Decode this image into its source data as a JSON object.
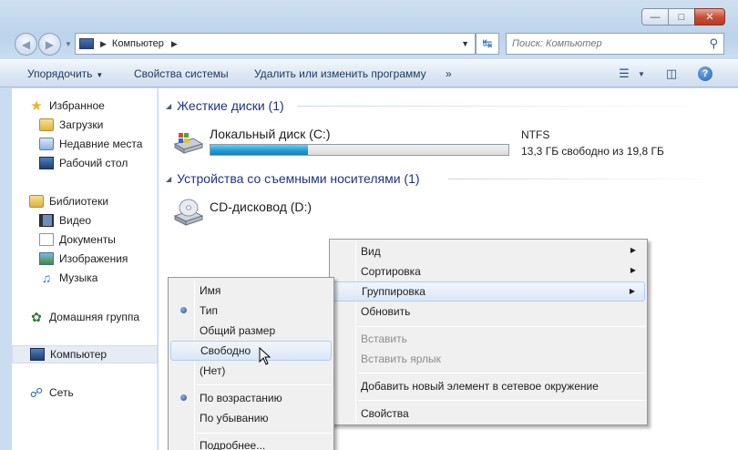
{
  "window": {
    "caption_buttons": [
      "minimize",
      "maximize",
      "close"
    ]
  },
  "navigation": {
    "address_path": "Компьютер",
    "search_placeholder": "Поиск: Компьютер"
  },
  "toolbar": {
    "organize_label": "Упорядочить",
    "system_properties_label": "Свойства системы",
    "uninstall_label": "Удалить или изменить программу",
    "more_label": "»",
    "help_label": "?"
  },
  "nav_pane": {
    "favorites": {
      "label": "Избранное",
      "items": [
        "Загрузки",
        "Недавние места",
        "Рабочий стол"
      ]
    },
    "libraries": {
      "label": "Библиотеки",
      "items": [
        "Видео",
        "Документы",
        "Изображения",
        "Музыка"
      ]
    },
    "homegroup": "Домашняя группа",
    "computer": "Компьютер",
    "network": "Сеть"
  },
  "content": {
    "group_hdd": "Жесткие диски (1)",
    "group_removable": "Устройства со съемными носителями (1)",
    "local_disk": {
      "name": "Локальный диск (C:)",
      "filesystem": "NTFS",
      "free_text": "13,3 ГБ свободно из 19,8 ГБ",
      "used_fraction": 0.328
    },
    "cd_drive": {
      "name": "CD-дисковод (D:)"
    }
  },
  "context_menu": {
    "items": [
      "Вид",
      "Сортировка",
      "Группировка",
      "Обновить",
      "Вставить",
      "Вставить ярлык",
      "Добавить новый элемент в сетевое окружение",
      "Свойства"
    ]
  },
  "group_submenu": {
    "items": [
      "Имя",
      "Тип",
      "Общий размер",
      "Свободно",
      "(Нет)",
      "По возрастанию",
      "По убыванию",
      "Подробнее..."
    ],
    "checked": [
      "Тип",
      "По возрастанию"
    ]
  }
}
